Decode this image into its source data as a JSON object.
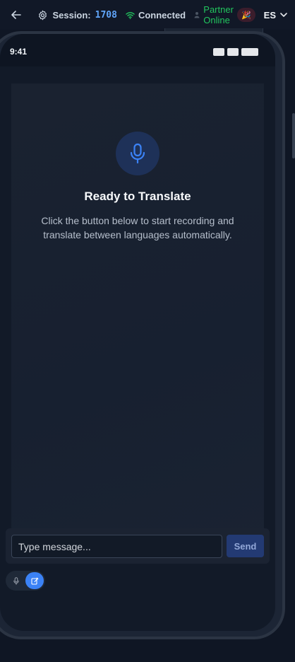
{
  "topbar": {
    "session_label": "Session:",
    "session_id": "1708",
    "status": "Connected",
    "partner_status": "Partner Online",
    "party_icon": "🎉",
    "language": "ES"
  },
  "phone": {
    "time": "9:41"
  },
  "main": {
    "title": "Ready to Translate",
    "description": "Click the button below to start recording and translate between languages automatically."
  },
  "composer": {
    "placeholder": "Type message...",
    "send_label": "Send"
  },
  "colors": {
    "accent": "#3b82f6",
    "connected": "#22c55e",
    "session": "#60a5fa"
  }
}
